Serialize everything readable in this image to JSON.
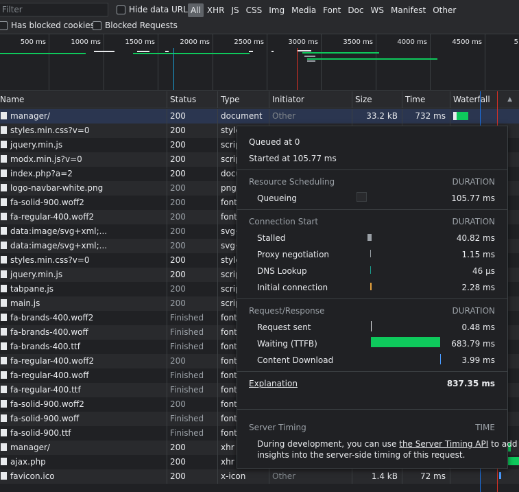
{
  "filter": {
    "placeholder": "Filter"
  },
  "checkboxes": {
    "hide_data_urls": "Hide data URLs",
    "has_blocked_cookies": "Has blocked cookies",
    "blocked_requests": "Blocked Requests"
  },
  "type_filters": [
    "All",
    "XHR",
    "JS",
    "CSS",
    "Img",
    "Media",
    "Font",
    "Doc",
    "WS",
    "Manifest",
    "Other"
  ],
  "overview_ticks": [
    "500 ms",
    "1000 ms",
    "1500 ms",
    "2000 ms",
    "2500 ms",
    "3000 ms",
    "3500 ms",
    "4000 ms",
    "4500 ms",
    "5"
  ],
  "columns": {
    "name": "Name",
    "status": "Status",
    "type": "Type",
    "initiator": "Initiator",
    "size": "Size",
    "time": "Time",
    "waterfall": "Waterfall"
  },
  "rows": [
    {
      "name": "manager/",
      "status": "200",
      "type": "document",
      "initiator": "Other",
      "size": "33.2 kB",
      "time": "732 ms"
    },
    {
      "name": "styles.min.css?v=0",
      "status": "200",
      "type": "style",
      "initiator": "",
      "size": "",
      "time": ""
    },
    {
      "name": "jquery.min.js",
      "status": "200",
      "type": "scrip",
      "initiator": "",
      "size": "",
      "time": ""
    },
    {
      "name": "modx.min.js?v=0",
      "status": "200",
      "type": "scrip",
      "initiator": "",
      "size": "",
      "time": ""
    },
    {
      "name": "index.php?a=2",
      "status": "200",
      "type": "docu",
      "initiator": "",
      "size": "",
      "time": ""
    },
    {
      "name": "logo-navbar-white.png",
      "status": "200",
      "type": "png",
      "initiator": "",
      "size": "",
      "time": ""
    },
    {
      "name": "fa-solid-900.woff2",
      "status": "200",
      "type": "font",
      "initiator": "",
      "size": "",
      "time": ""
    },
    {
      "name": "fa-regular-400.woff2",
      "status": "200",
      "type": "font",
      "initiator": "",
      "size": "",
      "time": ""
    },
    {
      "name": "data:image/svg+xml;...",
      "status": "200",
      "type": "svg+",
      "initiator": "",
      "size": "",
      "time": ""
    },
    {
      "name": "data:image/svg+xml;...",
      "status": "200",
      "type": "svg+",
      "initiator": "",
      "size": "",
      "time": ""
    },
    {
      "name": "styles.min.css?v=0",
      "status": "200",
      "type": "style",
      "initiator": "",
      "size": "",
      "time": ""
    },
    {
      "name": "jquery.min.js",
      "status": "200",
      "type": "scrip",
      "initiator": "",
      "size": "",
      "time": ""
    },
    {
      "name": "tabpane.js",
      "status": "200",
      "type": "scrip",
      "initiator": "",
      "size": "",
      "time": ""
    },
    {
      "name": "main.js",
      "status": "200",
      "type": "scrip",
      "initiator": "",
      "size": "",
      "time": ""
    },
    {
      "name": "fa-brands-400.woff2",
      "status": "Finished",
      "type": "font",
      "initiator": "",
      "size": "",
      "time": ""
    },
    {
      "name": "fa-brands-400.woff",
      "status": "Finished",
      "type": "font",
      "initiator": "",
      "size": "",
      "time": ""
    },
    {
      "name": "fa-brands-400.ttf",
      "status": "Finished",
      "type": "font",
      "initiator": "",
      "size": "",
      "time": ""
    },
    {
      "name": "fa-regular-400.woff2",
      "status": "200",
      "type": "font",
      "initiator": "",
      "size": "",
      "time": ""
    },
    {
      "name": "fa-regular-400.woff",
      "status": "Finished",
      "type": "font",
      "initiator": "",
      "size": "",
      "time": ""
    },
    {
      "name": "fa-regular-400.ttf",
      "status": "Finished",
      "type": "font",
      "initiator": "",
      "size": "",
      "time": ""
    },
    {
      "name": "fa-solid-900.woff2",
      "status": "200",
      "type": "font",
      "initiator": "",
      "size": "",
      "time": ""
    },
    {
      "name": "fa-solid-900.woff",
      "status": "Finished",
      "type": "font",
      "initiator": "",
      "size": "",
      "time": ""
    },
    {
      "name": "fa-solid-900.ttf",
      "status": "Finished",
      "type": "font",
      "initiator": "",
      "size": "",
      "time": ""
    },
    {
      "name": "manager/",
      "status": "200",
      "type": "xhr",
      "initiator": "",
      "size": "",
      "time": ""
    },
    {
      "name": "ajax.php",
      "status": "200",
      "type": "xhr",
      "initiator": "",
      "size": "",
      "time": ""
    },
    {
      "name": "favicon.ico",
      "status": "200",
      "type": "x-icon",
      "initiator": "Other",
      "size": "1.4 kB",
      "time": "72 ms"
    }
  ],
  "popover": {
    "queued": "Queued at 0",
    "started": "Started at 105.77 ms",
    "resource_scheduling": {
      "title": "Resource Scheduling",
      "dur": "DURATION",
      "items": [
        {
          "label": "Queueing",
          "value": "105.77 ms"
        }
      ]
    },
    "connection_start": {
      "title": "Connection Start",
      "dur": "DURATION",
      "items": [
        {
          "label": "Stalled",
          "value": "40.82 ms"
        },
        {
          "label": "Proxy negotiation",
          "value": "1.15 ms"
        },
        {
          "label": "DNS Lookup",
          "value": "46 µs"
        },
        {
          "label": "Initial connection",
          "value": "2.28 ms"
        }
      ]
    },
    "request_response": {
      "title": "Request/Response",
      "dur": "DURATION",
      "items": [
        {
          "label": "Request sent",
          "value": "0.48 ms"
        },
        {
          "label": "Waiting (TTFB)",
          "value": "683.79 ms"
        },
        {
          "label": "Content Download",
          "value": "3.99 ms"
        }
      ]
    },
    "explanation": "Explanation",
    "total": "837.35 ms",
    "server_timing": {
      "title": "Server Timing",
      "time_label": "TIME",
      "text_before": "During development, you can use ",
      "link": "the Server Timing API",
      "text_after": " to add",
      "text_line2": "insights into the server-side timing of this request."
    }
  },
  "colors": {
    "stalled": "#9aa0a6",
    "proxy": "#9aa0a6",
    "dns": "#1a9e8f",
    "initial": "#e8a33d",
    "request": "#e8eaed",
    "ttfb": "#0ec95c",
    "download": "#4a9bff",
    "dom_line": "#1a73e8",
    "load_line": "#d93025"
  }
}
